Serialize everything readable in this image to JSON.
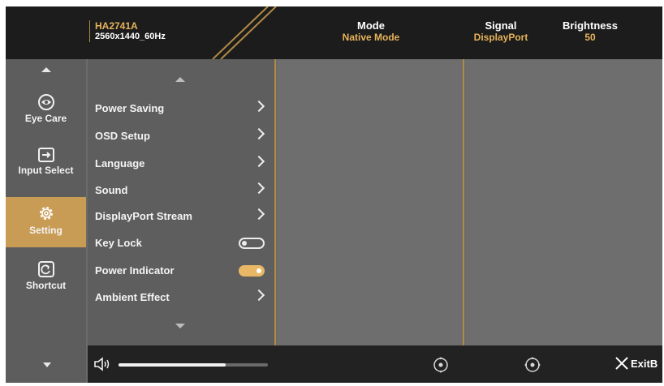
{
  "header": {
    "model": "HA2741A",
    "resolution": "2560x1440_60Hz",
    "status": [
      {
        "label": "Mode",
        "value": "Native Mode"
      },
      {
        "label": "Signal",
        "value": "DisplayPort"
      },
      {
        "label": "Brightness",
        "value": "50"
      }
    ]
  },
  "nav": {
    "items": [
      {
        "label": "Eye Care",
        "icon": "eye-care-icon"
      },
      {
        "label": "Input Select",
        "icon": "input-select-icon"
      },
      {
        "label": "Setting",
        "icon": "gear-icon",
        "active": true
      },
      {
        "label": "Shortcut",
        "icon": "shortcut-icon"
      }
    ]
  },
  "menu": {
    "items": [
      {
        "label": "Power Saving",
        "control": "chevron"
      },
      {
        "label": "OSD Setup",
        "control": "chevron"
      },
      {
        "label": "Language",
        "control": "chevron"
      },
      {
        "label": "Sound",
        "control": "chevron"
      },
      {
        "label": "DisplayPort Stream",
        "control": "chevron"
      },
      {
        "label": "Key Lock",
        "control": "toggle",
        "state": "off"
      },
      {
        "label": "Power Indicator",
        "control": "toggle",
        "state": "on"
      },
      {
        "label": "Ambient Effect",
        "control": "chevron"
      }
    ]
  },
  "bottom": {
    "volume_level": 0.72,
    "exit_label": "ExitB"
  },
  "colors": {
    "accent": "#e6b35a",
    "active_nav": "#c99c56",
    "header_bg": "#1c1c1c",
    "panel_bg": "#6b6b6b"
  }
}
